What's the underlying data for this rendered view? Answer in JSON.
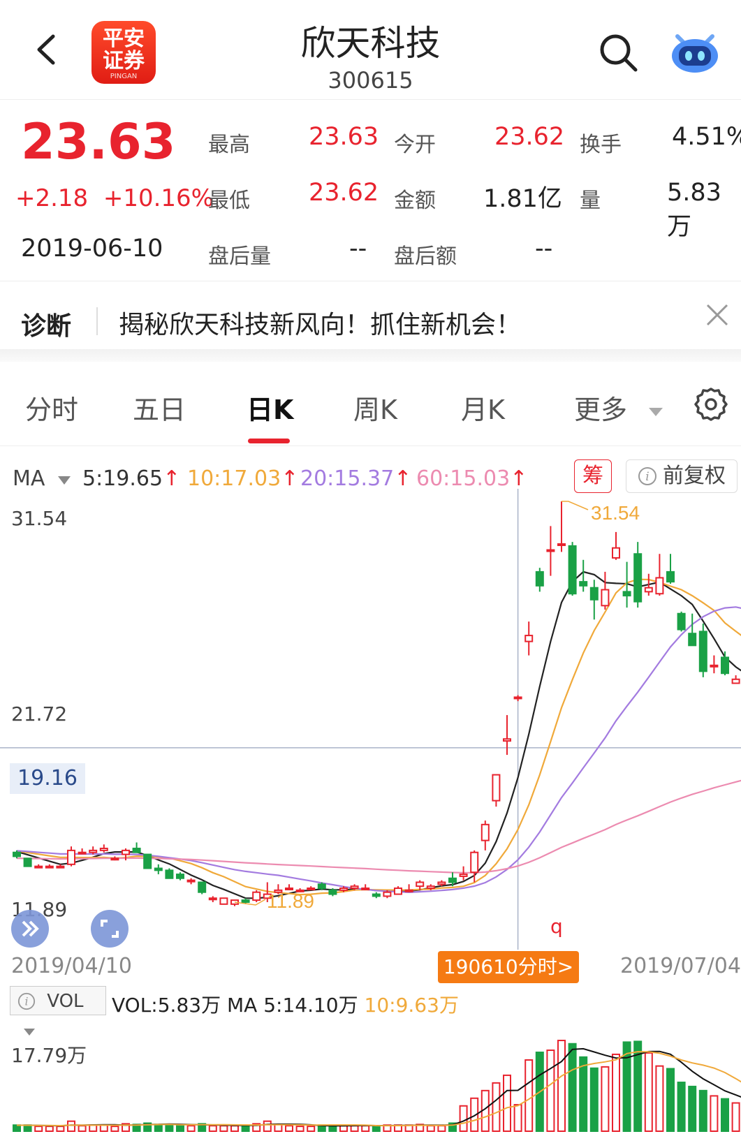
{
  "header": {
    "title": "欣天科技",
    "code": "300615"
  },
  "quote": {
    "price": "23.63",
    "change": "+2.18",
    "change_pct": "+10.16%",
    "date": "2019-06-10",
    "high_label": "最高",
    "high": "23.63",
    "low_label": "最低",
    "low": "23.62",
    "open_label": "今开",
    "open": "23.62",
    "amount_label": "金额",
    "amount": "1.81亿",
    "turnover_label": "换手",
    "turnover": "4.51%",
    "volume_label": "量",
    "volume": "5.83万",
    "after_vol_label": "盘后量",
    "after_vol": "--",
    "after_amt_label": "盘后额",
    "after_amt": "--"
  },
  "diagnosis": {
    "label": "诊断",
    "text": "揭秘欣天科技新风向！抓住新机会！"
  },
  "tabs": [
    "分时",
    "五日",
    "日K",
    "周K",
    "月K",
    "更多"
  ],
  "active_tab": "日K",
  "ma_row": {
    "label": "MA",
    "ma5": "5:19.65",
    "ma10": "10:17.03",
    "ma20": "20:15.37",
    "ma60": "60:15.03"
  },
  "chips": {
    "chou": "筹",
    "fuquan": "前复权"
  },
  "price_axis": {
    "top": "31.54",
    "mid": "21.72",
    "cross": "19.16",
    "bottom": "11.89"
  },
  "annotations": {
    "high": "31.54",
    "low": "11.89",
    "q": "q"
  },
  "date_axis": {
    "start": "2019/04/10",
    "end": "2019/07/04",
    "button": "190610分时>"
  },
  "vol_row": {
    "chip": "VOL",
    "vol": "VOL:5.83万",
    "ma5": "MA 5:14.10万",
    "ma10": "10:9.63万"
  },
  "vol_axis": {
    "max": "17.79万"
  },
  "colors": {
    "up": "#e8232e",
    "down": "#1aa146",
    "ma5": "#222222",
    "ma10": "#f0a93a",
    "ma20": "#a37be0",
    "ma60": "#ec8bb0"
  },
  "chart_data": {
    "type": "candlestick",
    "x_start": "2019/04/10",
    "x_end": "2019/07/04",
    "ylim": [
      11.89,
      31.54
    ],
    "ohlc_approx": [
      [
        13.9,
        14.0,
        13.6,
        13.7
      ],
      [
        13.6,
        13.6,
        13.2,
        13.2
      ],
      [
        13.2,
        13.3,
        13.1,
        13.2
      ],
      [
        13.2,
        13.3,
        13.1,
        13.2
      ],
      [
        13.2,
        13.3,
        13.1,
        13.2
      ],
      [
        13.3,
        14.2,
        13.2,
        14.0
      ],
      [
        13.9,
        14.1,
        13.8,
        13.9
      ],
      [
        13.9,
        14.2,
        13.8,
        14.0
      ],
      [
        14.0,
        14.3,
        13.9,
        14.1
      ],
      [
        13.6,
        13.7,
        13.5,
        13.6
      ],
      [
        13.8,
        14.1,
        13.5,
        14.0
      ],
      [
        14.1,
        14.4,
        13.9,
        13.9
      ],
      [
        13.8,
        13.8,
        13.1,
        13.1
      ],
      [
        13.1,
        13.3,
        12.8,
        13.0
      ],
      [
        13.0,
        13.1,
        12.6,
        12.6
      ],
      [
        12.8,
        12.9,
        12.5,
        12.6
      ],
      [
        12.5,
        12.6,
        12.3,
        12.5
      ],
      [
        12.4,
        12.4,
        11.8,
        11.9
      ],
      [
        11.6,
        11.7,
        11.4,
        11.6
      ],
      [
        11.3,
        11.6,
        11.3,
        11.6
      ],
      [
        11.3,
        11.5,
        11.2,
        11.5
      ],
      [
        11.5,
        11.6,
        11.3,
        11.4
      ],
      [
        11.5,
        12.0,
        11.4,
        11.9
      ],
      [
        11.6,
        12.4,
        11.4,
        11.8
      ],
      [
        11.9,
        12.3,
        11.8,
        12.0
      ],
      [
        12.1,
        12.3,
        12.0,
        12.1
      ],
      [
        12.0,
        12.1,
        11.9,
        12.0
      ],
      [
        12.1,
        12.2,
        12.0,
        12.1
      ],
      [
        12.3,
        12.4,
        12.0,
        12.1
      ],
      [
        12.0,
        12.1,
        11.7,
        11.8
      ],
      [
        12.0,
        12.2,
        11.9,
        12.1
      ],
      [
        12.1,
        12.3,
        12.0,
        12.2
      ],
      [
        12.1,
        12.3,
        12.0,
        12.1
      ],
      [
        11.8,
        11.9,
        11.6,
        11.7
      ],
      [
        11.7,
        12.0,
        11.6,
        11.9
      ],
      [
        11.8,
        12.2,
        11.8,
        12.1
      ],
      [
        12.0,
        12.3,
        11.9,
        12.0
      ],
      [
        12.2,
        12.5,
        12.0,
        12.4
      ],
      [
        12.1,
        12.3,
        12.0,
        12.2
      ],
      [
        12.3,
        12.5,
        12.2,
        12.4
      ],
      [
        12.6,
        12.9,
        12.2,
        12.4
      ],
      [
        12.7,
        13.2,
        12.5,
        12.8
      ],
      [
        12.9,
        14.0,
        12.4,
        13.9
      ],
      [
        14.5,
        15.5,
        14.0,
        15.3
      ],
      [
        16.5,
        17.8,
        16.2,
        17.8
      ],
      [
        19.5,
        20.8,
        18.8,
        19.6
      ],
      [
        21.7,
        21.8,
        21.5,
        21.7
      ],
      [
        24.5,
        25.5,
        23.8,
        24.8
      ],
      [
        28.0,
        28.2,
        27.0,
        27.3
      ],
      [
        29.1,
        30.3,
        27.8,
        29.1
      ],
      [
        29.4,
        31.54,
        29.0,
        29.4
      ],
      [
        29.3,
        29.5,
        26.8,
        26.9
      ],
      [
        27.5,
        28.6,
        27.0,
        27.3
      ],
      [
        27.2,
        27.6,
        25.6,
        26.6
      ],
      [
        26.3,
        28.0,
        26.1,
        27.1
      ],
      [
        28.7,
        30.0,
        28.6,
        29.2
      ],
      [
        27.0,
        28.5,
        26.2,
        26.8
      ],
      [
        28.9,
        29.5,
        26.2,
        26.5
      ],
      [
        27.0,
        27.9,
        26.8,
        27.2
      ],
      [
        26.9,
        28.9,
        26.8,
        27.7
      ],
      [
        28.0,
        28.9,
        27.4,
        27.5
      ],
      [
        25.9,
        26.0,
        25.0,
        25.1
      ],
      [
        24.9,
        25.9,
        24.3,
        24.3
      ],
      [
        25.0,
        25.4,
        22.7,
        23.0
      ],
      [
        23.3,
        23.8,
        22.9,
        23.3
      ],
      [
        23.7,
        24.0,
        22.8,
        22.9
      ],
      [
        22.4,
        22.8,
        22.4,
        22.6
      ],
      [
        22.4,
        22.6,
        22.1,
        22.4
      ]
    ]
  }
}
